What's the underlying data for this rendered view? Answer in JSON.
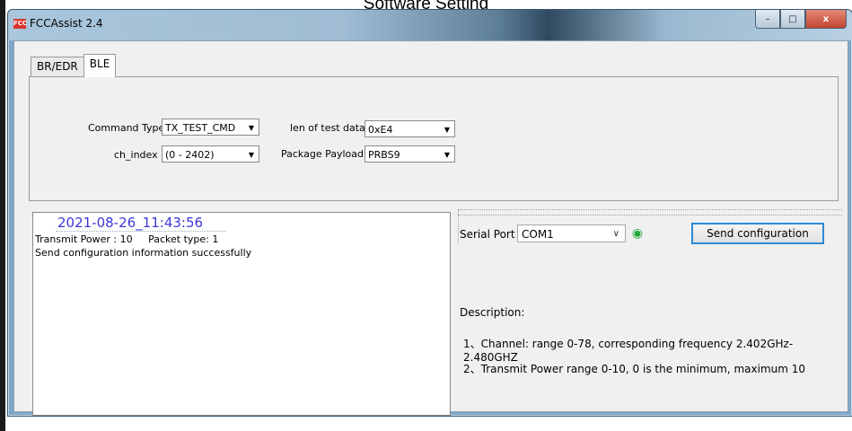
{
  "caption": "Software Setting",
  "window": {
    "title": "FCCAssist 2.4",
    "icon_text": "FCC",
    "controls": {
      "minimize": "–",
      "maximize": "□",
      "close": "x"
    }
  },
  "tabs": [
    {
      "label": "BR/EDR",
      "active": false
    },
    {
      "label": "BLE",
      "active": true
    }
  ],
  "form": {
    "command_type": {
      "label": "Command Type",
      "value": "TX_TEST_CMD"
    },
    "ch_index": {
      "label": "ch_index",
      "value": "(0 - 2402)"
    },
    "len_of_test_data": {
      "label": "len of test data",
      "value": "0xE4"
    },
    "package_payload": {
      "label": "Package Payload",
      "value": "PRBS9"
    }
  },
  "log": {
    "timestamp": "2021-08-26_11:43:56",
    "line1": "Transmit Power : 10     Packet type: 1",
    "line2": "Send configuration information successfully"
  },
  "serial": {
    "label": "Serial Port",
    "value": "COM1"
  },
  "send_button": "Send configuration",
  "description": {
    "heading": "Description:",
    "items": [
      "1、Channel: range 0-78, corresponding frequency 2.402GHz-2.480GHZ",
      "2、Transmit Power  range 0-10, 0 is the minimum, maximum 10"
    ]
  },
  "colors": {
    "timestamp": "#3a38d8",
    "focus_border": "#2a8ad6",
    "signal_icon": "#1fa83a"
  }
}
